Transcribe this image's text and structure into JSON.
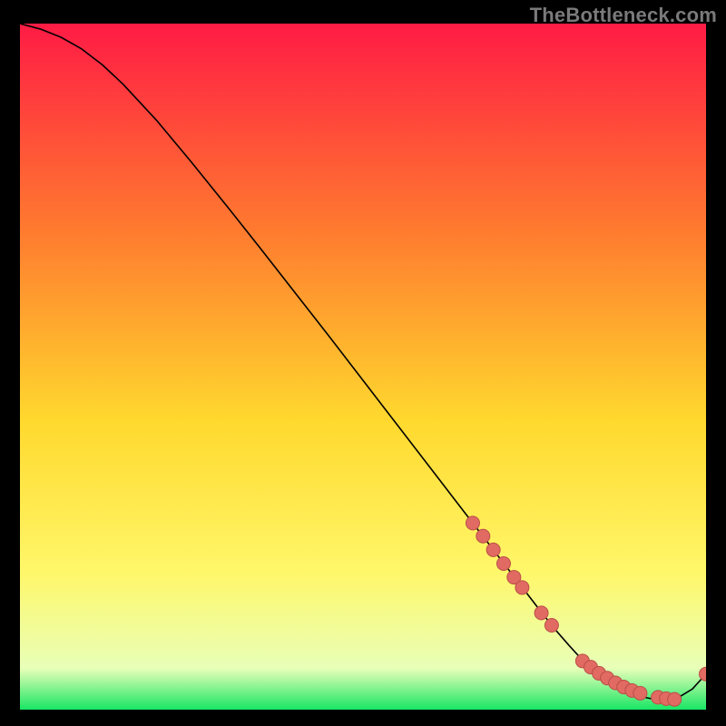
{
  "watermark": "TheBottleneck.com",
  "colors": {
    "page_bg": "#000000",
    "grad_top": "#ff1b45",
    "grad_mid1": "#ff7a2f",
    "grad_mid2": "#ffd92e",
    "grad_mid3": "#fff76a",
    "grad_bottom_band": "#e8ffb8",
    "grad_bottom": "#18e664",
    "line": "#000000",
    "marker_fill": "#e16a63",
    "marker_stroke": "#bb4e48"
  },
  "chart_data": {
    "type": "line",
    "title": "",
    "xlabel": "",
    "ylabel": "",
    "xlim": [
      0,
      100
    ],
    "ylim": [
      0,
      100
    ],
    "series": [
      {
        "name": "curve",
        "x": [
          0,
          3,
          6,
          9,
          12,
          15,
          20,
          25,
          30,
          35,
          40,
          45,
          50,
          55,
          60,
          64,
          66,
          68,
          70,
          72,
          74,
          76,
          78,
          80,
          82,
          84,
          86,
          88,
          90,
          92,
          94,
          96,
          98,
          100
        ],
        "y": [
          100,
          99.2,
          98.0,
          96.3,
          94.0,
          91.2,
          85.8,
          79.8,
          73.6,
          67.3,
          60.9,
          54.5,
          48.0,
          41.5,
          35.0,
          29.8,
          27.2,
          24.6,
          22.0,
          19.4,
          16.8,
          14.2,
          11.7,
          9.4,
          7.2,
          5.4,
          3.9,
          2.8,
          2.0,
          1.6,
          1.5,
          1.8,
          3.0,
          5.2
        ]
      }
    ],
    "markers": {
      "name": "dots",
      "x": [
        66,
        67.5,
        69,
        70.5,
        72,
        73.2,
        76,
        77.5,
        82,
        83.2,
        84.4,
        85.6,
        86.8,
        88,
        89.2,
        90.4,
        93,
        94.2,
        95.4,
        100
      ],
      "y": [
        27.2,
        25.3,
        23.3,
        21.3,
        19.3,
        17.8,
        14.1,
        12.3,
        7.1,
        6.2,
        5.3,
        4.6,
        3.9,
        3.3,
        2.8,
        2.4,
        1.8,
        1.6,
        1.5,
        5.2
      ]
    }
  }
}
